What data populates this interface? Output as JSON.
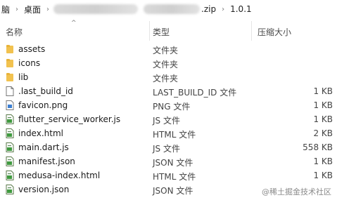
{
  "breadcrumb": {
    "items": [
      "脑",
      "桌面",
      "",
      ".zip",
      "1.0.1"
    ]
  },
  "columns": {
    "name": "名称",
    "type": "类型",
    "size": "压缩大小"
  },
  "files": [
    {
      "name": "assets",
      "type": "文件夹",
      "size": "",
      "icon": "folder-icon"
    },
    {
      "name": "icons",
      "type": "文件夹",
      "size": "",
      "icon": "folder-icon"
    },
    {
      "name": "lib",
      "type": "文件夹",
      "size": "",
      "icon": "folder-icon"
    },
    {
      "name": ".last_build_id",
      "type": "LAST_BUILD_ID 文件",
      "size": "1 KB",
      "icon": "file-icon"
    },
    {
      "name": "favicon.png",
      "type": "PNG 文件",
      "size": "1 KB",
      "icon": "image-file-icon"
    },
    {
      "name": "flutter_service_worker.js",
      "type": "JS 文件",
      "size": "1 KB",
      "icon": "script-file-icon"
    },
    {
      "name": "index.html",
      "type": "HTML 文件",
      "size": "2 KB",
      "icon": "script-file-icon"
    },
    {
      "name": "main.dart.js",
      "type": "JS 文件",
      "size": "558 KB",
      "icon": "script-file-icon"
    },
    {
      "name": "manifest.json",
      "type": "JSON 文件",
      "size": "1 KB",
      "icon": "script-file-icon"
    },
    {
      "name": "medusa-index.html",
      "type": "HTML 文件",
      "size": "1 KB",
      "icon": "script-file-icon"
    },
    {
      "name": "version.json",
      "type": "JSON 文件",
      "size": "",
      "icon": "script-file-icon"
    }
  ],
  "watermark": "@稀土掘金技术社区"
}
